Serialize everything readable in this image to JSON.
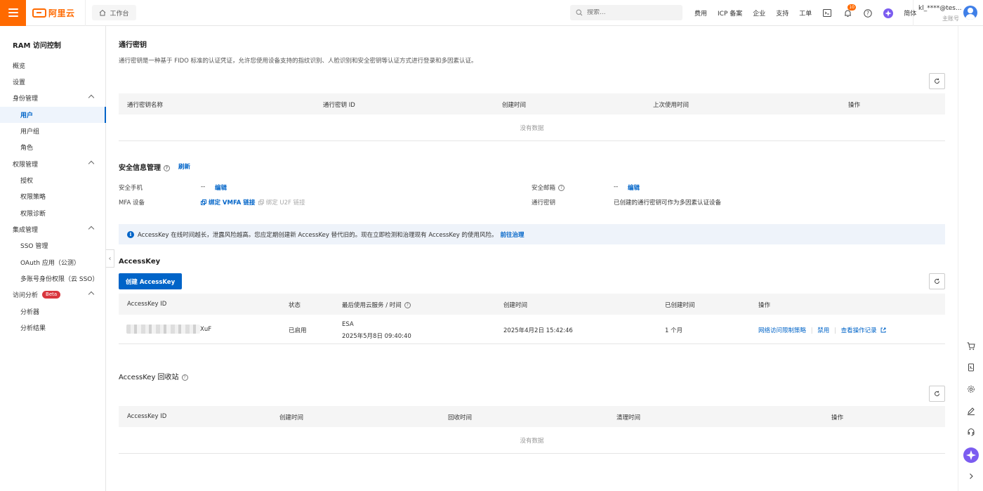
{
  "topbar": {
    "brand": "阿里云",
    "workbench": "工作台",
    "search_placeholder": "搜索...",
    "links": [
      "费用",
      "ICP 备案",
      "企业",
      "支持",
      "工单"
    ],
    "notification_count": "10",
    "lang": "简体",
    "user_name": "kl_****@tes...",
    "user_role": "主账号"
  },
  "sidebar": {
    "title": "RAM 访问控制",
    "items": [
      {
        "label": "概览"
      },
      {
        "label": "设置"
      },
      {
        "label": "身份管理"
      },
      {
        "label": "用户"
      },
      {
        "label": "用户组"
      },
      {
        "label": "角色"
      },
      {
        "label": "权限管理"
      },
      {
        "label": "授权"
      },
      {
        "label": "权限策略"
      },
      {
        "label": "权限诊断"
      },
      {
        "label": "集成管理"
      },
      {
        "label": "SSO 管理"
      },
      {
        "label": "OAuth 应用（公测）"
      },
      {
        "label": "多账号身份权限（云 SSO）"
      },
      {
        "label": "访问分析"
      },
      {
        "label": "分析器"
      },
      {
        "label": "分析结果"
      }
    ],
    "beta_badge": "Beta"
  },
  "passkey": {
    "title": "通行密钥",
    "desc": "通行密钥是一种基于 FIDO 标准的认证凭证，允许您使用设备支持的指纹识别、人脸识别和安全密钥等认证方式进行登录和多因素认证。",
    "columns": [
      "通行密钥名称",
      "通行密钥 ID",
      "创建时间",
      "上次使用时间",
      "操作"
    ],
    "empty": "没有数据"
  },
  "security": {
    "title": "安全信息管理",
    "refresh": "刷新",
    "phone_label": "安全手机",
    "phone_value": "--",
    "phone_edit": "编辑",
    "mfa_label": "MFA 设备",
    "bind_vmfa": "绑定 VMFA 链接",
    "bind_u2f": "绑定 U2F 链接",
    "email_label": "安全邮箱",
    "email_value": "--",
    "email_edit": "编辑",
    "passkey_label": "通行密钥",
    "passkey_value": "已创建的通行密钥可作为多因素认证设备"
  },
  "notice": {
    "text": "AccessKey 在线时间越长，泄露风险越高。您应定期创建新 AccessKey 替代旧的。现在立即检测和治理现有 AccessKey 的使用风险。",
    "link": "前往治理"
  },
  "accesskey": {
    "title": "AccessKey",
    "create_button": "创建 AccessKey",
    "columns": [
      "AccessKey ID",
      "状态",
      "最后使用云服务 / 时间",
      "创建时间",
      "已创建时间",
      "操作"
    ],
    "rows": [
      {
        "id_suffix": "XuF",
        "status": "已启用",
        "last_service": "ESA",
        "last_time": "2025年5月8日 09:40:40",
        "created": "2025年4月2日 15:42:46",
        "age": "1 个月",
        "actions": [
          "网络访问限制策略",
          "禁用",
          "查看操作记录"
        ]
      }
    ]
  },
  "recycle": {
    "title": "AccessKey 回收站",
    "columns": [
      "AccessKey ID",
      "创建时间",
      "回收时间",
      "清理时间",
      "操作"
    ],
    "empty": "没有数据"
  }
}
